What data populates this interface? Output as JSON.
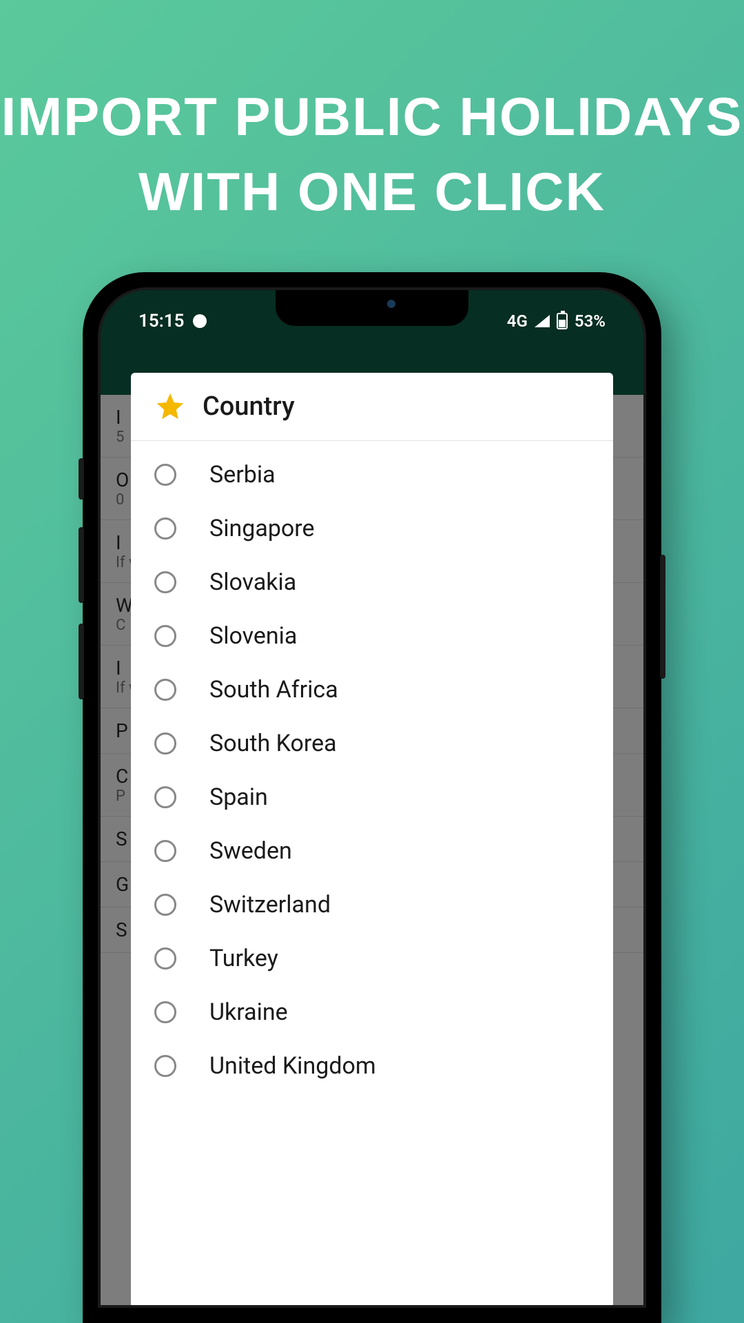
{
  "headline": {
    "line1": "Import public holidays",
    "line2": "with one click"
  },
  "statusBar": {
    "time": "15:15",
    "network": "4G",
    "battery": "53%"
  },
  "dialog": {
    "title": "Country",
    "countries": [
      "Serbia",
      "Singapore",
      "Slovakia",
      "Slovenia",
      "South Africa",
      "South Korea",
      "Spain",
      "Sweden",
      "Switzerland",
      "Turkey",
      "Ukraine",
      "United Kingdom"
    ]
  },
  "bgItems": [
    {
      "title": "I",
      "sub": "5"
    },
    {
      "title": "O",
      "sub": "0"
    },
    {
      "title": "I",
      "sub": "If\nw"
    },
    {
      "title": "W",
      "sub": "C"
    },
    {
      "title": "I",
      "sub": "If\nw"
    },
    {
      "title": "P",
      "sub": ""
    },
    {
      "title": "C",
      "sub": "P"
    },
    {
      "title": "S",
      "sub": ""
    },
    {
      "title": "G",
      "sub": ""
    },
    {
      "title": "S",
      "sub": ""
    }
  ]
}
